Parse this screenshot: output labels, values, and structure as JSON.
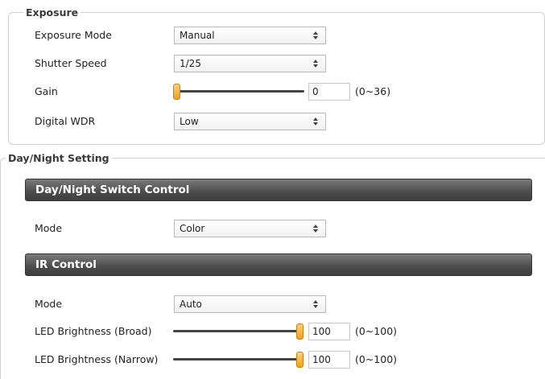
{
  "exposure": {
    "legend": "Exposure",
    "mode_label": "Exposure Mode",
    "mode_value": "Manual",
    "shutter_label": "Shutter Speed",
    "shutter_value": "1/25",
    "gain_label": "Gain",
    "gain_value": "0",
    "gain_fraction": 0.0,
    "gain_range": "(0~36)",
    "wdr_label": "Digital WDR",
    "wdr_value": "Low"
  },
  "daynight": {
    "legend": "Day/Night Setting",
    "switch_header": "Day/Night Switch Control",
    "switch_mode_label": "Mode",
    "switch_mode_value": "Color",
    "ir_header": "IR Control",
    "ir_mode_label": "Mode",
    "ir_mode_value": "Auto",
    "led_broad_label": "LED Brightness (Broad)",
    "led_broad_value": "100",
    "led_broad_fraction": 1.0,
    "led_broad_range": "(0~100)",
    "led_narrow_label": "LED Brightness (Narrow)",
    "led_narrow_value": "100",
    "led_narrow_fraction": 1.0,
    "led_narrow_range": "(0~100)"
  },
  "colors": {
    "slider_thumb": "#f0a020",
    "header_bar": "#4b4b4b"
  }
}
